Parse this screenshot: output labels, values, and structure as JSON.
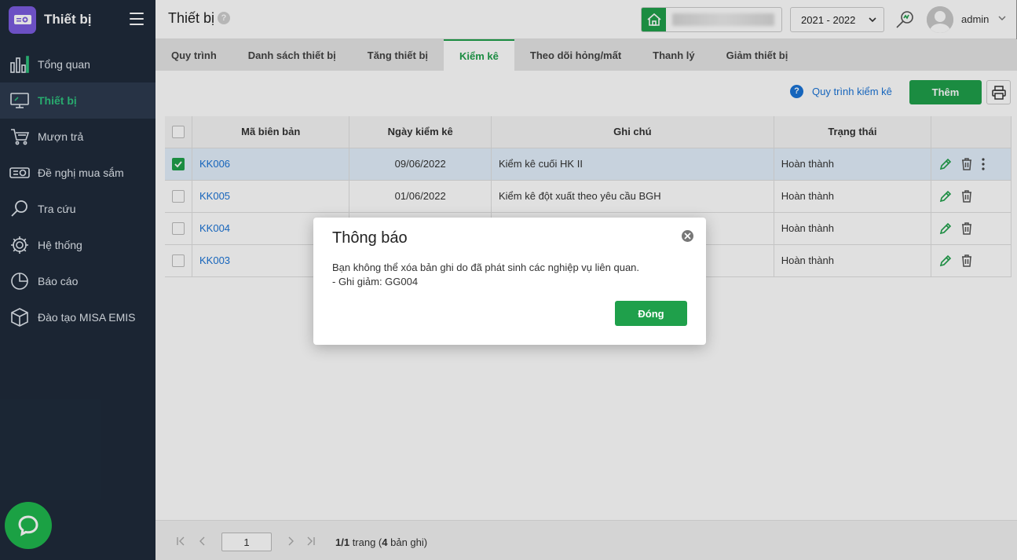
{
  "sidebar": {
    "brand_title": "Thiết bị",
    "items": [
      {
        "label": "Tổng quan",
        "icon": "bar-chart-icon"
      },
      {
        "label": "Thiết bị",
        "icon": "monitor-icon",
        "active": true
      },
      {
        "label": "Mượn trả",
        "icon": "cart-icon"
      },
      {
        "label": "Đề nghị mua sắm",
        "icon": "projector-icon"
      },
      {
        "label": "Tra cứu",
        "icon": "search-icon"
      },
      {
        "label": "Hệ thống",
        "icon": "gear-icon"
      },
      {
        "label": "Báo cáo",
        "icon": "pie-chart-icon"
      },
      {
        "label": "Đào tạo MISA EMIS",
        "icon": "cube-icon"
      }
    ]
  },
  "header": {
    "page_title": "Thiết bị",
    "help_symbol": "?",
    "school_year": "2021 - 2022",
    "username": "admin"
  },
  "tabs": [
    {
      "label": "Quy trình"
    },
    {
      "label": "Danh sách thiết bị"
    },
    {
      "label": "Tăng thiết bị"
    },
    {
      "label": "Kiểm kê",
      "active": true
    },
    {
      "label": "Theo dõi hỏng/mất"
    },
    {
      "label": "Thanh lý"
    },
    {
      "label": "Giảm thiết bị"
    }
  ],
  "toolbar": {
    "process_link_icon": "?",
    "process_link": "Quy trình kiểm kê",
    "add_label": "Thêm"
  },
  "table": {
    "columns": [
      "Mã biên bản",
      "Ngày kiểm kê",
      "Ghi chú",
      "Trạng thái"
    ],
    "rows": [
      {
        "code": "KK006",
        "date": "09/06/2022",
        "note": "Kiểm kê cuối HK II",
        "status": "Hoàn thành",
        "checked": true
      },
      {
        "code": "KK005",
        "date": "01/06/2022",
        "note": "Kiểm kê đột xuất theo yêu cầu BGH",
        "status": "Hoàn thành",
        "checked": false
      },
      {
        "code": "KK004",
        "date": "",
        "note": "",
        "status": "Hoàn thành",
        "checked": false
      },
      {
        "code": "KK003",
        "date": "",
        "note": "",
        "status": "Hoàn thành",
        "checked": false
      }
    ]
  },
  "pager": {
    "current_page": "1",
    "info_prefix": "1/1",
    "info_middle": " trang (",
    "info_count": "4",
    "info_suffix": " bản ghi)"
  },
  "modal": {
    "title": "Thông báo",
    "line1": "Bạn không thể xóa bản ghi do đã phát sinh các nghiệp vụ liên quan.",
    "line2": "- Ghi giảm: GG004",
    "close_label": "Đóng"
  },
  "colors": {
    "accent": "#1fa04b",
    "link": "#1a73d6",
    "sidebar_bg": "#1f2b3b"
  }
}
